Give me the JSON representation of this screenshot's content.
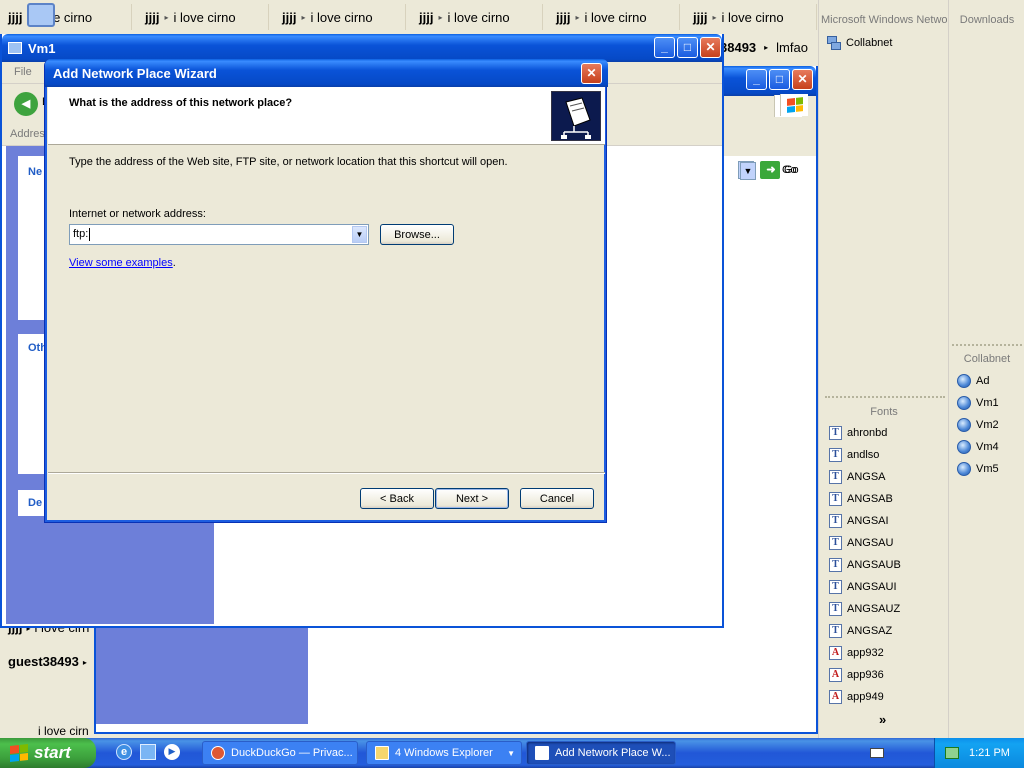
{
  "top_strip": [
    {
      "who": "jjjj",
      "msg": "love cirno"
    },
    {
      "who": "jjjj",
      "msg": "i love cirno"
    },
    {
      "who": "jjjj",
      "msg": "i love cirno"
    },
    {
      "who": "jjjj",
      "msg": "i love cirno"
    },
    {
      "who": "jjjj",
      "msg": "i love cirno"
    },
    {
      "who": "jjjj",
      "msg": "i love cirno"
    }
  ],
  "right_panel_top": {
    "title": "Microsoft Windows Network",
    "items": [
      "Collabnet"
    ]
  },
  "downloads_panel": {
    "title": "Downloads"
  },
  "collabnet_panel": {
    "title": "Collabnet",
    "items": [
      "Ad",
      "Vm1",
      "Vm2",
      "Vm4",
      "Vm5"
    ]
  },
  "fonts_panel": {
    "title": "Fonts",
    "items": [
      {
        "label": "ahronbd",
        "icon": "truetype-font-icon"
      },
      {
        "label": "andlso",
        "icon": "truetype-font-icon"
      },
      {
        "label": "ANGSA",
        "icon": "truetype-font-icon"
      },
      {
        "label": "ANGSAB",
        "icon": "truetype-font-icon"
      },
      {
        "label": "ANGSAI",
        "icon": "truetype-font-icon"
      },
      {
        "label": "ANGSAU",
        "icon": "truetype-font-icon"
      },
      {
        "label": "ANGSAUB",
        "icon": "truetype-font-icon"
      },
      {
        "label": "ANGSAUI",
        "icon": "truetype-font-icon"
      },
      {
        "label": "ANGSAUZ",
        "icon": "truetype-font-icon"
      },
      {
        "label": "ANGSAZ",
        "icon": "truetype-font-icon"
      },
      {
        "label": "app932",
        "icon": "opentype-font-icon"
      },
      {
        "label": "app936",
        "icon": "opentype-font-icon"
      },
      {
        "label": "app949",
        "icon": "opentype-font-icon"
      }
    ],
    "more": "»"
  },
  "chat_behind": {
    "line1": "38493",
    "line1_suffix": "lmfao",
    "bottom": [
      {
        "who": "jjjj",
        "msg": "i love cirn"
      },
      {
        "who": "guest38493",
        "msg": ""
      },
      {
        "who": "",
        "msg": "i love cirn"
      }
    ]
  },
  "vm1_window": {
    "title": "Vm1",
    "menu_file": "File",
    "back_label": "B",
    "address_label": "Addres",
    "go_label": "Go",
    "left_tasks": [
      "Ne",
      "Oth",
      "De"
    ]
  },
  "explorer2": {
    "go_label": "Go"
  },
  "wizard": {
    "title": "Add Network Place Wizard",
    "heading": "What is the address of this network place?",
    "instruction": "Type the address of the Web site, FTP site, or network location that this shortcut will open.",
    "address_label": "Internet or network address:",
    "address_value": "ftp:",
    "browse": "Browse...",
    "examples_link": "View some examples",
    "examples_period": ".",
    "back": "< Back",
    "next": "Next >",
    "cancel": "Cancel"
  },
  "taskbar": {
    "start": "start",
    "tasks": [
      {
        "label": "DuckDuckGo — Privac...",
        "icon": "duckduckgo-icon",
        "active": false
      },
      {
        "label": "4  Windows Explorer",
        "icon": "folder-icon",
        "active": false
      },
      {
        "label": "Add Network Place W...",
        "icon": "wizard-window-icon",
        "active": true
      }
    ],
    "clock": "1:21 PM"
  },
  "colors": {
    "xp_blue": "#0a53d8",
    "task_pane": "#6d7fd9",
    "face": "#ece9d8",
    "link": "#0000ff"
  }
}
